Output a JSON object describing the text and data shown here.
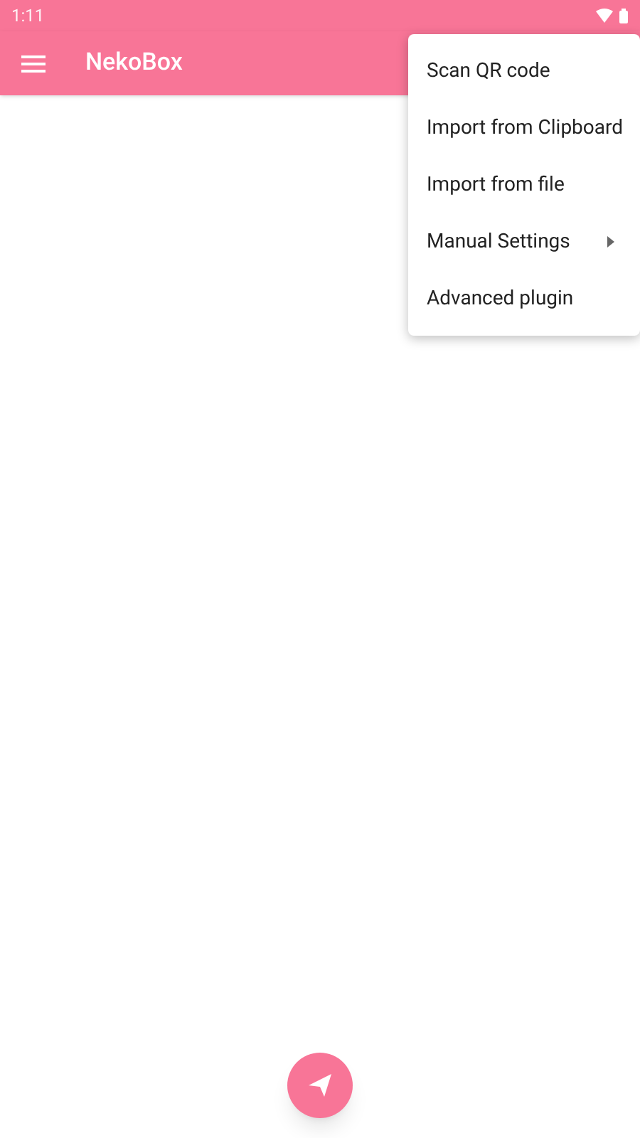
{
  "status_bar": {
    "time": "1:11"
  },
  "app_bar": {
    "title": "NekoBox"
  },
  "menu": {
    "items": [
      {
        "label": "Scan QR code",
        "kind": "action"
      },
      {
        "label": "Import from Clipboard",
        "kind": "action"
      },
      {
        "label": "Import from file",
        "kind": "action"
      },
      {
        "label": "Manual Settings",
        "kind": "submenu"
      },
      {
        "label": "Advanced plugin",
        "kind": "action"
      }
    ]
  }
}
